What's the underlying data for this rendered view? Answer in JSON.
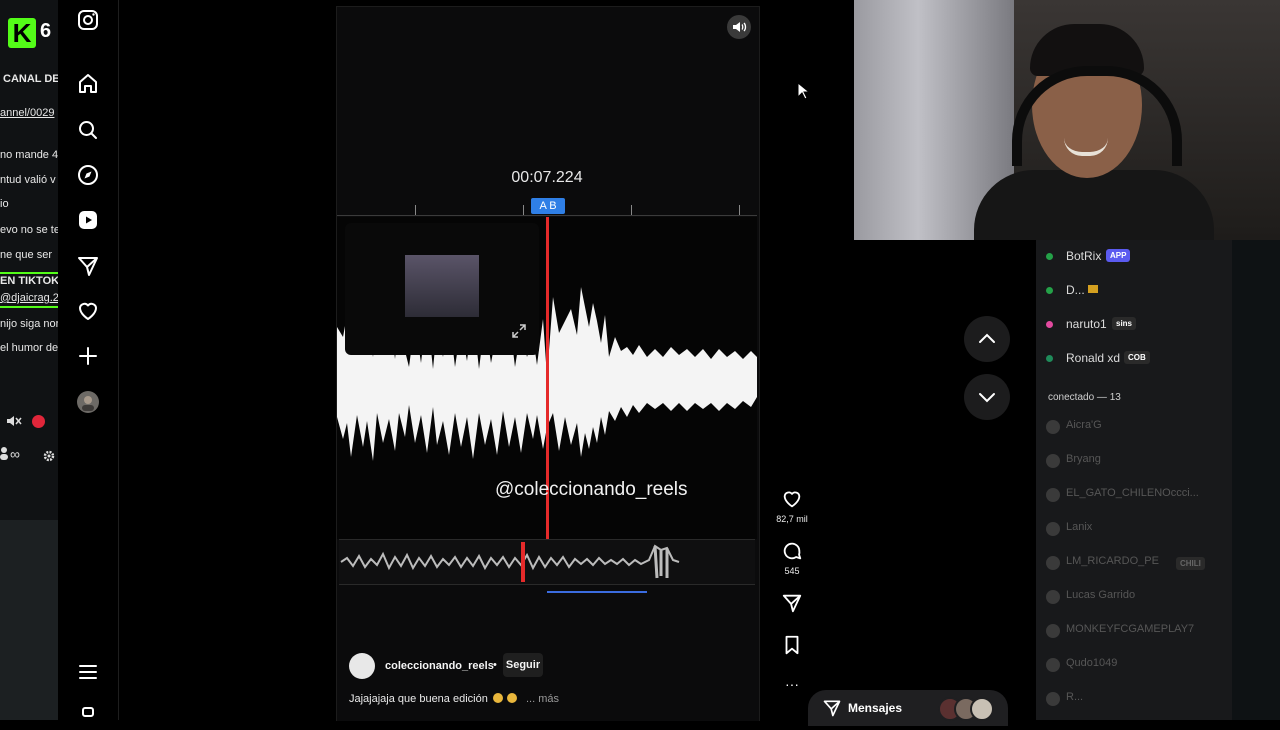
{
  "left_panel": {
    "logo_letter": "K",
    "logo_number": "6",
    "lines": [
      "CANAL DE",
      "annel/0029",
      "no mande 4",
      "ntud valió v",
      "io",
      "evo no se te",
      "ne que ser",
      "EN TIKTOK",
      "@djaicrag.26",
      "nijo siga nor",
      "el humor de"
    ],
    "infinity_symbol": "∞"
  },
  "nav": {
    "icons": [
      "instagram-icon",
      "home-icon",
      "search-icon",
      "explore-icon",
      "reels-icon",
      "messages-icon",
      "notifications-icon",
      "create-icon",
      "profile-icon",
      "menu-icon"
    ]
  },
  "reel": {
    "timestamp": "00:07.224",
    "ab_marker": "A B",
    "watermark": "@coleccionando_reels",
    "author": "coleccionando_reels",
    "dot": "•",
    "follow_label": "Seguir",
    "caption_text": "Jajajajaja que buena edición",
    "caption_more": "... más",
    "likes": "82,7 mil",
    "comments": "545",
    "more_label": "···"
  },
  "messages": {
    "label": "Mensajes"
  },
  "chat": {
    "users": [
      {
        "name": "BotRix",
        "badge": "APP",
        "badge_color": "#5b5bf0",
        "dot": "#24a148"
      },
      {
        "name": "D...",
        "badge": "",
        "dot": "#24a148"
      },
      {
        "name": "naruto1",
        "badge": "sins",
        "badge_color": "#2a2a2a",
        "dot": "#e24aa0"
      },
      {
        "name": "Ronald xd",
        "badge": "COB",
        "badge_color": "#2a2a2a",
        "dot": "#1f8b5a"
      }
    ],
    "section_title": "conectado — 13",
    "members": [
      "Aicra'G",
      "Bryang",
      "EL_GATO_CHILENOccci...",
      "Lanix",
      "LM_RICARDO_PE",
      "Lucas Garrido",
      "MONKEYFCGAMEPLAY7",
      "Qudo1049",
      "R..."
    ],
    "member_badge": "CHILI"
  },
  "colors": {
    "accent_green": "#53fc18",
    "playhead": "#e52a2a",
    "ab_marker": "#2f7fe6"
  }
}
